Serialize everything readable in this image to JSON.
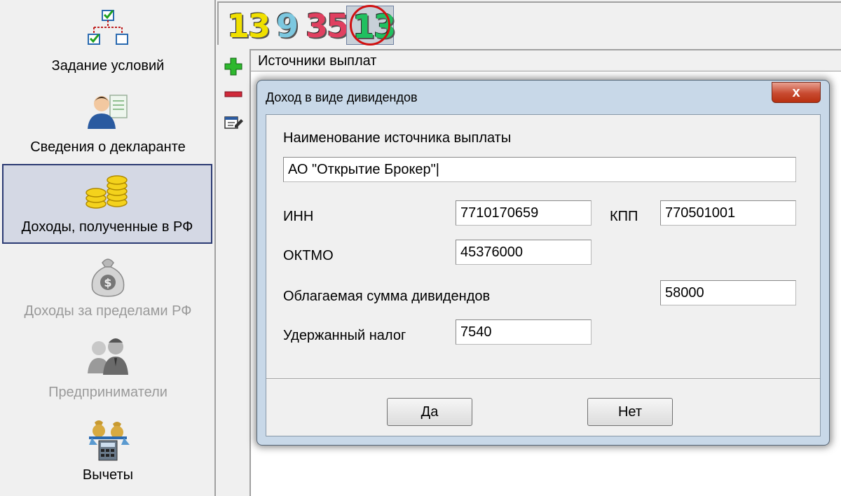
{
  "sidebar": {
    "items": [
      {
        "label": "Задание условий",
        "icon": "hierarchy-checkbox-icon",
        "state": "normal"
      },
      {
        "label": "Сведения о декларанте",
        "icon": "person-document-icon",
        "state": "normal"
      },
      {
        "label": "Доходы, полученные в РФ",
        "icon": "gold-coins-icon",
        "state": "active"
      },
      {
        "label": "Доходы за пределами РФ",
        "icon": "money-bag-icon",
        "state": "disabled"
      },
      {
        "label": "Предприниматели",
        "icon": "businessmen-icon",
        "state": "disabled"
      },
      {
        "label": "Вычеты",
        "icon": "scales-calculator-icon",
        "state": "normal"
      }
    ]
  },
  "indicators": {
    "values": [
      "13",
      "9",
      "35",
      "13"
    ],
    "colors": [
      "#f0e000",
      "#7cc8e0",
      "#e04060",
      "#20c060"
    ],
    "selected_index": 3
  },
  "toolbar": {
    "icons": [
      "add-icon",
      "remove-icon",
      "edit-icon"
    ]
  },
  "panel": {
    "header": "Источники выплат"
  },
  "dialog": {
    "title": "Доход в виде дивидендов",
    "close_label": "x",
    "fields": {
      "source_name": {
        "label": "Наименование источника выплаты",
        "value": "АО \"Открытие Брокер\"|"
      },
      "inn": {
        "label": "ИНН",
        "value": "7710170659"
      },
      "kpp": {
        "label": "КПП",
        "value": "770501001"
      },
      "oktmo": {
        "label": "ОКТМО",
        "value": "45376000"
      },
      "dividend_sum": {
        "label": "Облагаемая сумма дивидендов",
        "value": "58000"
      },
      "withheld_tax": {
        "label": "Удержанный налог",
        "value": "7540"
      }
    },
    "buttons": {
      "ok": "Да",
      "cancel": "Нет"
    }
  },
  "colors": {
    "dialog_frame": "#c8d8e8",
    "close_button": "#c84a30",
    "active_sidebar_bg": "#d4d8e4",
    "active_sidebar_border": "#2b3a73"
  }
}
